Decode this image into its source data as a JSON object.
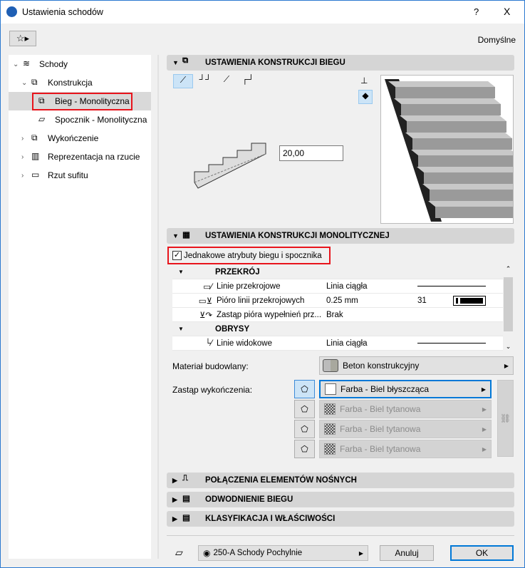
{
  "window": {
    "title": "Ustawienia schodów",
    "help": "?",
    "close": "X"
  },
  "toolbar": {
    "preset": "Domyślne"
  },
  "tree": [
    {
      "label": "Schody"
    },
    {
      "label": "Konstrukcja"
    },
    {
      "label": "Bieg - Monolityczna"
    },
    {
      "label": "Spocznik - Monolityczna"
    },
    {
      "label": "Wykończenie"
    },
    {
      "label": "Reprezentacja na rzucie"
    },
    {
      "label": "Rzut sufitu"
    }
  ],
  "sections": {
    "run": {
      "title": "USTAWIENIA KONSTRUKCJI BIEGU",
      "angle": "20,00"
    },
    "mono": {
      "title": "USTAWIENIA KONSTRUKCJI MONOLITYCZNEJ",
      "checkbox": "Jednakowe atrybuty biegu i spocznika",
      "checked": true
    },
    "collapsed": [
      "POŁĄCZENIA ELEMENTÓW NOŚNYCH",
      "ODWODNIENIE BIEGU",
      "KLASYFIKACJA I WŁAŚCIWOŚCI"
    ]
  },
  "table": {
    "groups": [
      "PRZEKRÓJ",
      "OBRYSY"
    ],
    "rows": [
      {
        "label": "Linie przekrojowe",
        "value": "Linia ciągła"
      },
      {
        "label": "Pióro linii przekrojowych",
        "value": "0.25 mm",
        "pen": "31"
      },
      {
        "label": "Zastąp pióra wypełnień prz...",
        "value": "Brak"
      },
      {
        "label": "Linie widokowe",
        "value": "Linia ciągła"
      }
    ]
  },
  "material": {
    "label": "Materiał budowlany:",
    "value": "Beton konstrukcyjny"
  },
  "finish": {
    "label": "Zastąp wykończenia:",
    "items": [
      "Farba - Biel błyszcząca",
      "Farba - Biel tytanowa",
      "Farba - Biel tytanowa",
      "Farba - Biel tytanowa"
    ]
  },
  "footer": {
    "layer": "250-A Schody Pochylnie",
    "cancel": "Anuluj",
    "ok": "OK"
  }
}
